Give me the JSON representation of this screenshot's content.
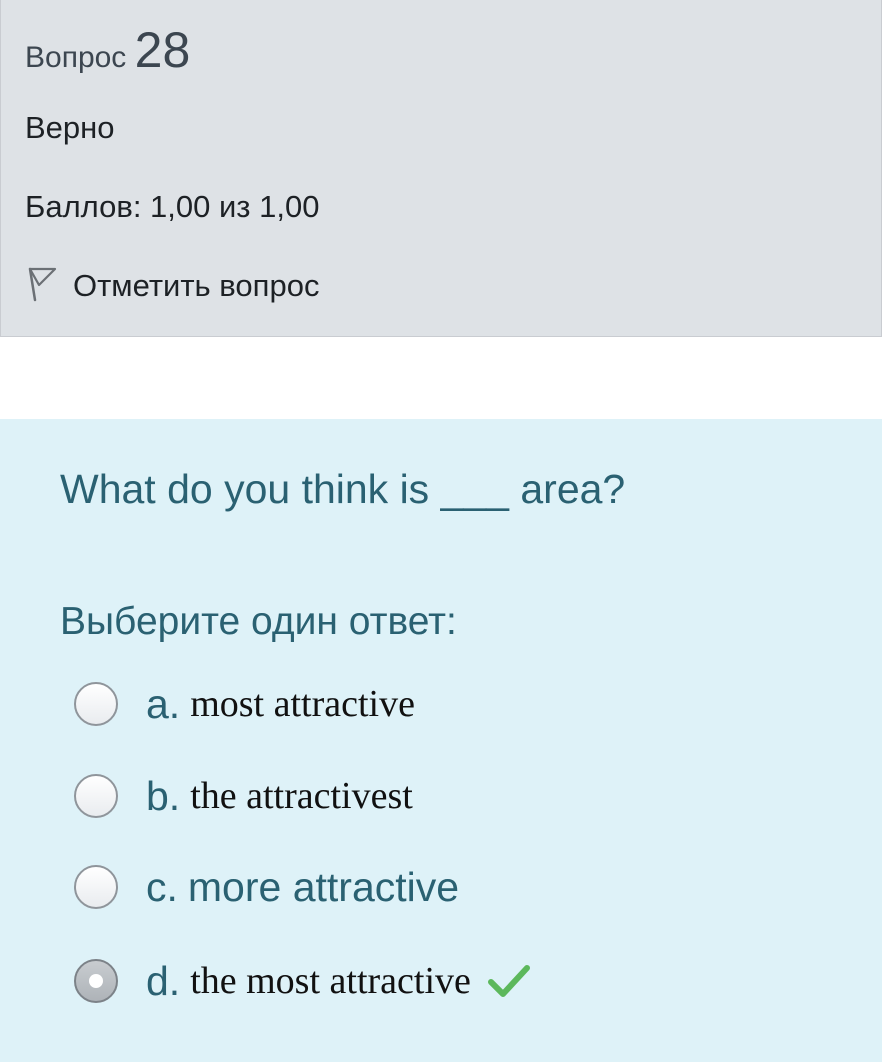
{
  "info": {
    "question_label": "Вопрос",
    "question_number": "28",
    "state": "Верно",
    "grade": "Баллов: 1,00 из 1,00",
    "flag_label": "Отметить вопрос",
    "flag_icon": "flag-icon"
  },
  "question": {
    "text": "What do you think is ___ area?",
    "prompt": "Выберите один ответ:"
  },
  "options": [
    {
      "letter": "a.",
      "text": "most attractive",
      "selected": false
    },
    {
      "letter": "b.",
      "text": "the attractivest",
      "selected": false
    },
    {
      "letter": "c.",
      "text": "more attractive",
      "selected": false
    },
    {
      "letter": "d.",
      "text": "the most attractive",
      "selected": true,
      "correct_icon": "checkmark-icon"
    }
  ],
  "colors": {
    "info_bg": "#dee2e6",
    "content_bg": "#def2f8",
    "accent_text": "#2a6172",
    "correct": "#5cb85c"
  }
}
